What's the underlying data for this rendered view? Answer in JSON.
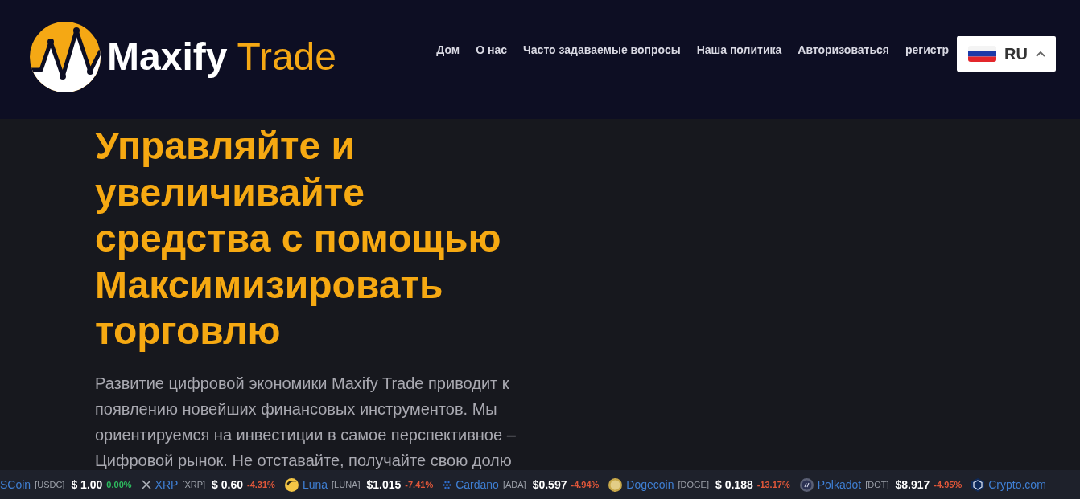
{
  "header": {
    "logo": {
      "name": "Maxify",
      "suffix": "Trade"
    },
    "nav": [
      "Дом",
      "О нас",
      "Часто задаваемые вопросы",
      "Наша политика",
      "Авторизоваться",
      "регистр"
    ],
    "language": {
      "code": "RU"
    }
  },
  "hero": {
    "heading": "Управляйте и увеличивайте средства с помощью Максимизировать торговлю",
    "text": "Развитие цифровой экономики Maxify Trade приводит к появлению новейших финансовых инструментов. Мы ориентируемся на инвестиции в самое перспективное – Цифровой рынок. Не отставайте, получайте свою долю"
  },
  "ticker": [
    {
      "name": "SCoin",
      "symbol": "[USDC]",
      "price": "$ 1.00",
      "change": "0.00%",
      "color": "#2ebd5f"
    },
    {
      "name": "XRP",
      "symbol": "[XRP]",
      "price": "$ 0.60",
      "change": "-4.31%",
      "color": "#e0573a"
    },
    {
      "name": "Luna",
      "symbol": "[LUNA]",
      "price": "$1.015",
      "change": "-7.41%",
      "color": "#e0573a"
    },
    {
      "name": "Cardano",
      "symbol": "[ADA]",
      "price": "$0.597",
      "change": "-4.94%",
      "color": "#e0573a"
    },
    {
      "name": "Dogecoin",
      "symbol": "[DOGE]",
      "price": "$ 0.188",
      "change": "-13.17%",
      "color": "#e0573a"
    },
    {
      "name": "Polkadot",
      "symbol": "[DOT]",
      "price": "$8.917",
      "change": "-4.95%",
      "color": "#e0573a"
    },
    {
      "name": "Crypto.com"
    }
  ]
}
